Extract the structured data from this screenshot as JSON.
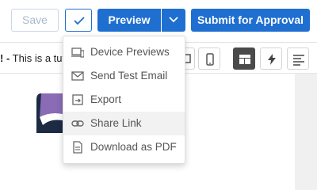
{
  "toolbar": {
    "save_label": "Save",
    "preview_label": "Preview",
    "submit_label": "Submit for Approval",
    "accent_color": "#1f6fd1"
  },
  "subbar": {
    "subject_prefix": "! -",
    "subject_text": " This is a tut"
  },
  "preview_menu": {
    "items": [
      {
        "label": "Device Previews",
        "icon": "devices-icon"
      },
      {
        "label": "Send Test Email",
        "icon": "envelope-icon"
      },
      {
        "label": "Export",
        "icon": "export-icon"
      },
      {
        "label": "Share Link",
        "icon": "link-icon",
        "highlighted": true
      },
      {
        "label": "Download as PDF",
        "icon": "pdf-file-icon"
      }
    ]
  },
  "view_tools": [
    {
      "icon": "desktop-icon"
    },
    {
      "icon": "mobile-icon"
    },
    {
      "icon": "layout-icon",
      "active": true
    },
    {
      "icon": "lightning-icon"
    },
    {
      "icon": "text-align-icon"
    }
  ]
}
